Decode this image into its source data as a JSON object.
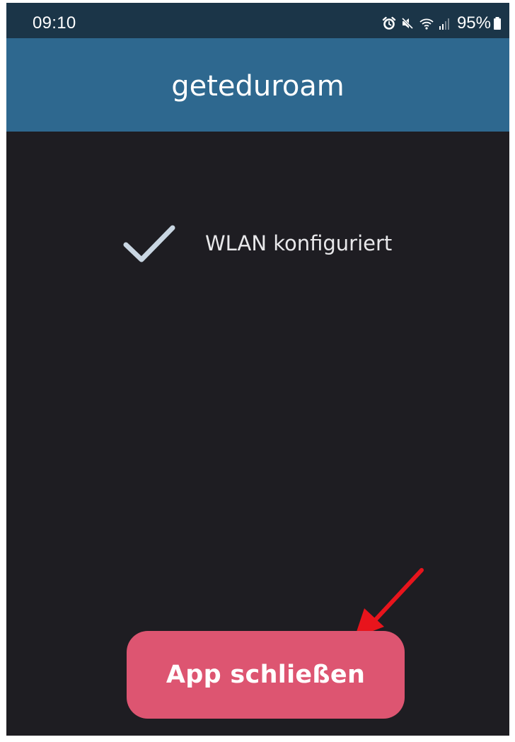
{
  "status_bar": {
    "time": "09:10",
    "battery_percent": "95%",
    "icons": [
      "alarm-icon",
      "mute-icon",
      "wifi-icon",
      "signal-icon",
      "battery-icon"
    ]
  },
  "app_bar": {
    "title": "geteduroam"
  },
  "content": {
    "status_message": "WLAN konfiguriert",
    "status_icon": "checkmark-icon"
  },
  "actions": {
    "close_button_label": "App schließen"
  },
  "annotation": {
    "type": "arrow",
    "color": "#e8141c",
    "points_to": "close-app-button"
  },
  "colors": {
    "status_bar": "#1b3548",
    "app_bar": "#2e688f",
    "background": "#1e1d22",
    "button": "#dd5571",
    "check": "#c9d6e2"
  }
}
